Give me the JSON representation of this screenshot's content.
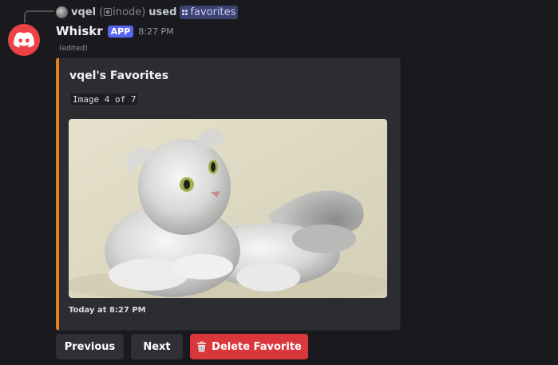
{
  "reply": {
    "username": "vqel",
    "handle_open": "(",
    "handle": "inode)",
    "used_text": "used",
    "command": "favorites"
  },
  "message": {
    "author": "Whiskr",
    "badge": "APP",
    "timestamp": "8:27 PM",
    "edited": "(edited)"
  },
  "embed": {
    "accent_color": "#e67e22",
    "title": "vqel's Favorites",
    "description": "Image 4 of 7",
    "image_subject": "cat-photo",
    "footer": "Today at 8:27 PM"
  },
  "buttons": {
    "previous": "Previous",
    "next": "Next",
    "delete": "Delete Favorite",
    "delete_icon": "trash-icon"
  },
  "colors": {
    "app_badge": "#5865f2",
    "avatar": "#ed4245",
    "danger_button": "#da373c",
    "secondary_button": "#2e3035"
  }
}
